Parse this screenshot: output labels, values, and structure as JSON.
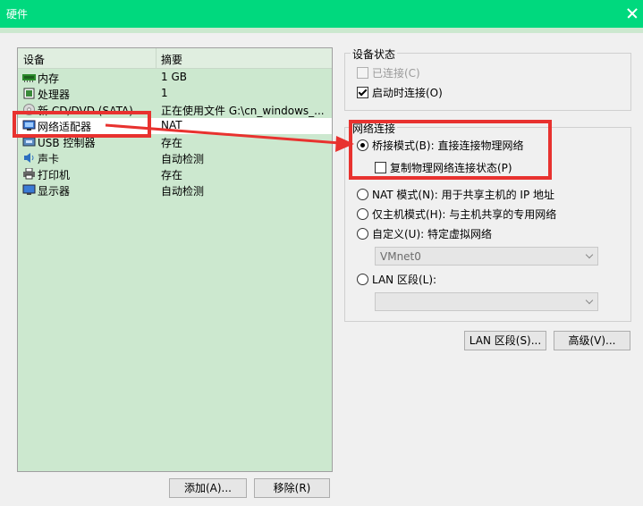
{
  "window": {
    "title": "硬件"
  },
  "table": {
    "headers": {
      "device": "设备",
      "summary": "摘要"
    },
    "rows": [
      {
        "icon": "memory-icon",
        "device": "内存",
        "summary": "1 GB"
      },
      {
        "icon": "processor-icon",
        "device": "处理器",
        "summary": "1"
      },
      {
        "icon": "cd-dvd-icon",
        "device": "新 CD/DVD (SATA)",
        "summary": "正在使用文件 G:\\cn_windows_..."
      },
      {
        "icon": "network-adapter-icon",
        "device": "网络适配器",
        "summary": "NAT"
      },
      {
        "icon": "usb-icon",
        "device": "USB 控制器",
        "summary": "存在"
      },
      {
        "icon": "sound-icon",
        "device": "声卡",
        "summary": "自动检测"
      },
      {
        "icon": "printer-icon",
        "device": "打印机",
        "summary": "存在"
      },
      {
        "icon": "display-icon",
        "device": "显示器",
        "summary": "自动检测"
      }
    ]
  },
  "buttons": {
    "add": "添加(A)...",
    "remove": "移除(R)",
    "lan_segments": "LAN 区段(S)...",
    "advanced": "高级(V)..."
  },
  "device_status": {
    "label": "设备状态",
    "connected": "已连接(C)",
    "connect_on_start": "启动时连接(O)"
  },
  "network": {
    "label": "网络连接",
    "bridged": "桥接模式(B): 直接连接物理网络",
    "replicate": "复制物理网络连接状态(P)",
    "nat": "NAT 模式(N): 用于共享主机的 IP 地址",
    "host_only": "仅主机模式(H): 与主机共享的专用网络",
    "custom": "自定义(U): 特定虚拟网络",
    "custom_value": "VMnet0",
    "lan": "LAN 区段(L):",
    "lan_value": ""
  },
  "colors": {
    "annotation": "#e8322f",
    "title_bar": "#00d97e",
    "eye_care_green": "#cce8cf"
  }
}
